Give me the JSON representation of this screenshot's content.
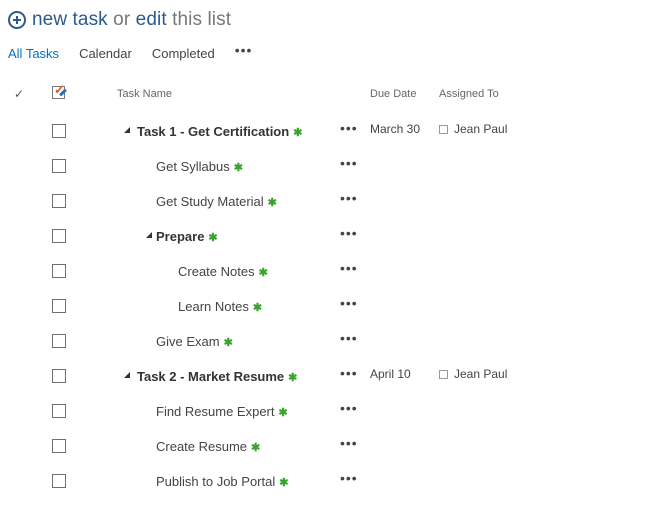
{
  "hero": {
    "new_task": "new task",
    "or": "or",
    "edit": "edit",
    "this_list": "this list"
  },
  "views": {
    "items": [
      "All Tasks",
      "Calendar",
      "Completed"
    ],
    "more": "•••"
  },
  "table": {
    "check_col": "✓",
    "headers": {
      "task_name": "Task Name",
      "due_date": "Due Date",
      "assigned_to": "Assigned To"
    },
    "ellipsis": "•••",
    "new_marker": "✱",
    "rows": [
      {
        "name": "Task 1 - Get Certification",
        "due": "March 30",
        "assigned": "Jean Paul"
      },
      {
        "name": "Get Syllabus",
        "due": "",
        "assigned": ""
      },
      {
        "name": "Get Study Material",
        "due": "",
        "assigned": ""
      },
      {
        "name": "Prepare",
        "due": "",
        "assigned": ""
      },
      {
        "name": "Create Notes",
        "due": "",
        "assigned": ""
      },
      {
        "name": "Learn Notes",
        "due": "",
        "assigned": ""
      },
      {
        "name": "Give Exam",
        "due": "",
        "assigned": ""
      },
      {
        "name": "Task 2 - Market Resume",
        "due": "April 10",
        "assigned": "Jean Paul"
      },
      {
        "name": "Find Resume Expert",
        "due": "",
        "assigned": ""
      },
      {
        "name": "Create Resume",
        "due": "",
        "assigned": ""
      },
      {
        "name": "Publish to Job Portal",
        "due": "",
        "assigned": ""
      }
    ]
  }
}
